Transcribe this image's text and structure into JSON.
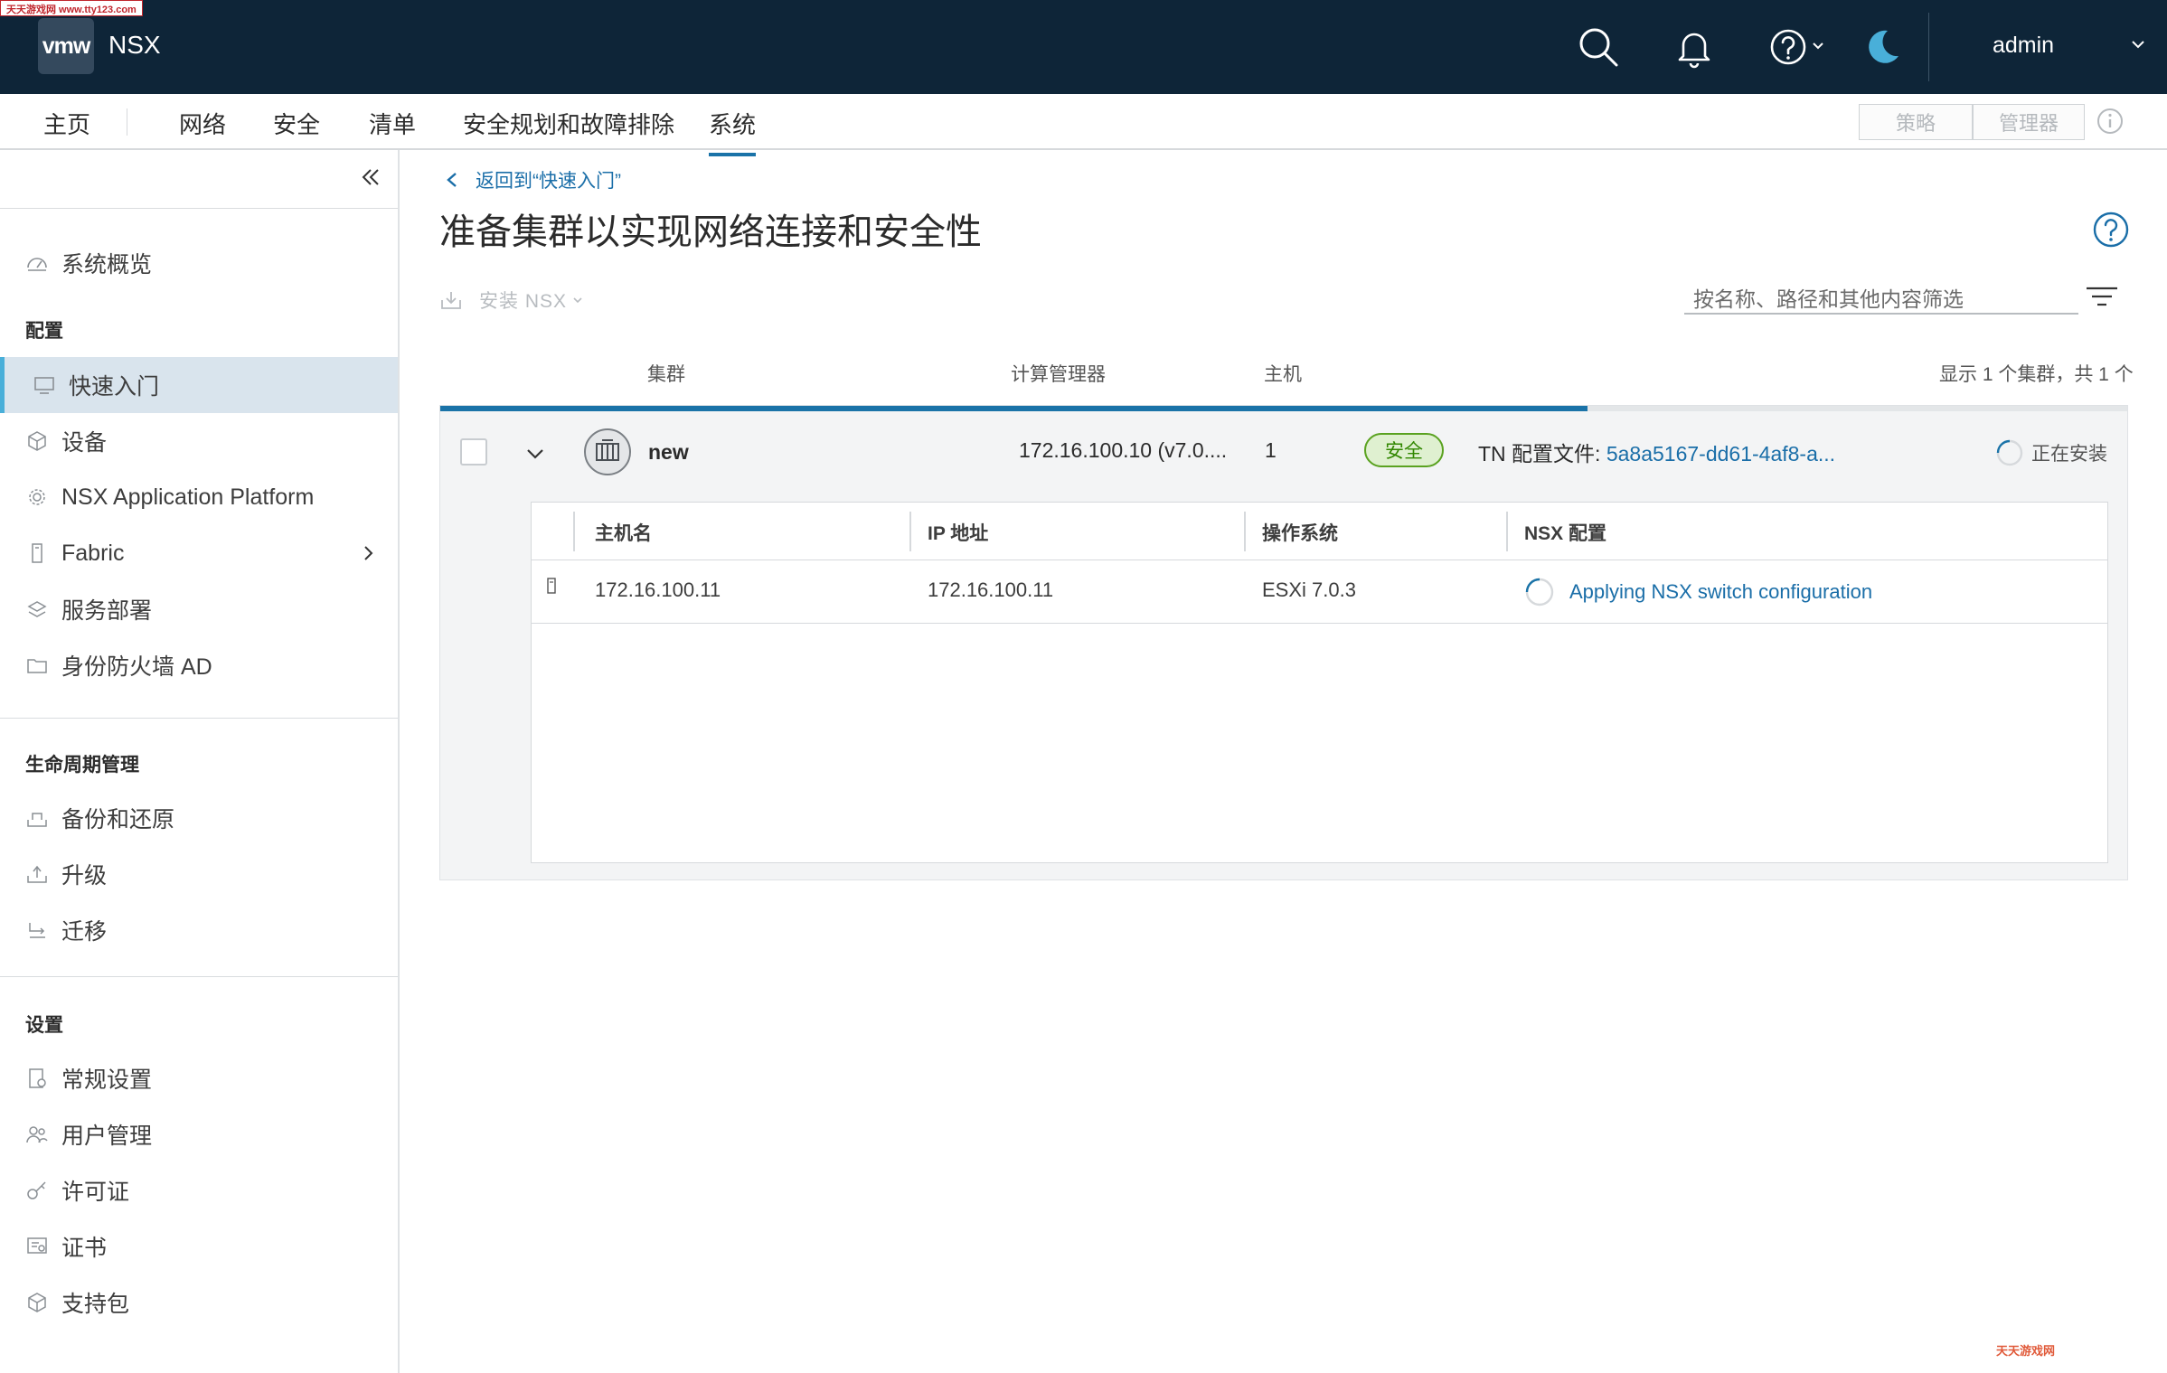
{
  "watermark": {
    "top": "天天游戏网 www.tty123.com",
    "bottom": "天天游戏网"
  },
  "header": {
    "logo": "vmw",
    "product": "NSX",
    "user": "admin",
    "icons": [
      "search-icon",
      "bell-icon",
      "help-icon",
      "moon-icon",
      "chevron-down-icon"
    ],
    "colors": {
      "bar": "#0e2538",
      "accent": "#1a73a8",
      "moon": "#49afd9"
    }
  },
  "nav": {
    "items": [
      "主页",
      "网络",
      "安全",
      "清单",
      "安全规划和故障排除",
      "系统"
    ],
    "active": "系统",
    "mode_toggle": [
      "策略",
      "管理器"
    ]
  },
  "sidebar": {
    "overview": "系统概览",
    "section_config": "配置",
    "config_items": [
      "快速入门",
      "设备",
      "NSX Application Platform",
      "Fabric",
      "服务部署",
      "身份防火墙 AD"
    ],
    "active_item": "快速入门",
    "section_lifecycle": "生命周期管理",
    "lifecycle_items": [
      "备份和还原",
      "升级",
      "迁移"
    ],
    "section_settings": "设置",
    "settings_items": [
      "常规设置",
      "用户管理",
      "许可证",
      "证书",
      "支持包"
    ]
  },
  "main": {
    "back_link": "返回到“快速入门”",
    "title": "准备集群以实现网络连接和安全性",
    "install_action": "安装 NSX",
    "filter_placeholder": "按名称、路径和其他内容筛选",
    "columns": {
      "cluster": "集群",
      "compute_manager": "计算管理器",
      "hosts": "主机"
    },
    "count_text": "显示 1 个集群，共 1 个",
    "progress_fraction": 0.68,
    "cluster_row": {
      "name": "new",
      "compute_manager": "172.16.100.10 (v7.0....",
      "hosts": "1",
      "badge": "安全",
      "tn_label": "TN 配置文件:",
      "tn_value": "5a8a5167-dd61-4af8-a...",
      "status": "正在安装"
    },
    "host_table": {
      "headers": {
        "hostname": "主机名",
        "ip": "IP 地址",
        "os": "操作系统",
        "nsx_config": "NSX 配置"
      },
      "rows": [
        {
          "hostname": "172.16.100.11",
          "ip": "172.16.100.11",
          "os": "ESXi 7.0.3",
          "nsx_config": "Applying NSX switch configuration"
        }
      ]
    }
  }
}
